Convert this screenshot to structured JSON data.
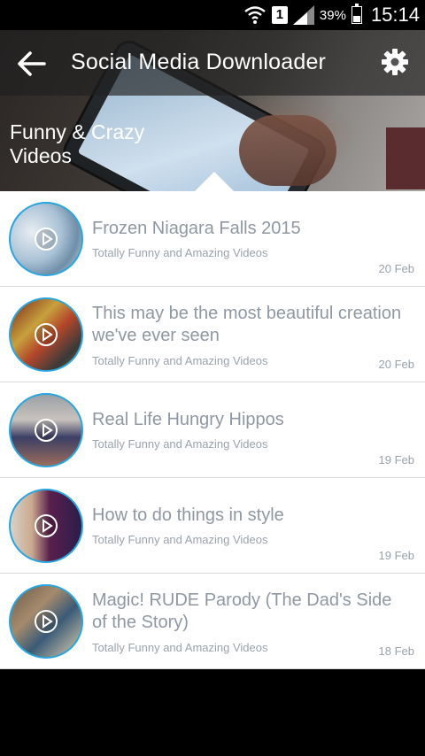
{
  "status_bar": {
    "sim_label": "1",
    "battery_percent": "39%",
    "battery_level": 0.39,
    "time": "15:14"
  },
  "toolbar": {
    "title": "Social Media Downloader",
    "back_icon": "back-arrow-icon",
    "settings_icon": "gear-icon"
  },
  "category": {
    "line1": "Funny & Crazy",
    "line2": "Videos"
  },
  "videos": [
    {
      "title": "Frozen Niagara Falls 2015",
      "channel": "Totally Funny and Amazing Videos",
      "date": "20 Feb"
    },
    {
      "title": "This may be the most beautiful creation we've ever seen",
      "channel": "Totally Funny and Amazing Videos",
      "date": "20 Feb"
    },
    {
      "title": "Real Life Hungry Hippos",
      "channel": "Totally Funny and Amazing Videos",
      "date": "19 Feb"
    },
    {
      "title": "How to do things in style",
      "channel": "Totally Funny and Amazing Videos",
      "date": "19 Feb"
    },
    {
      "title": "Magic! RUDE Parody (The Dad's Side of the Story)",
      "channel": "Totally Funny and Amazing Videos",
      "date": "18 Feb"
    }
  ],
  "colors": {
    "thumb_border": "#2aa6dd",
    "text_gray": "#8f98a2"
  }
}
